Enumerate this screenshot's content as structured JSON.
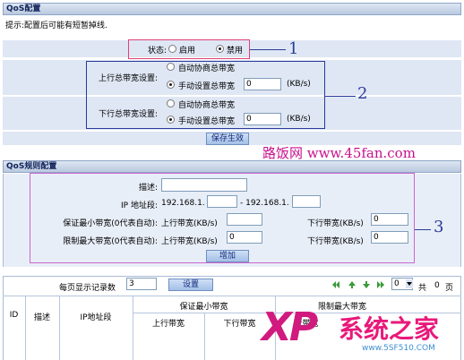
{
  "qos": {
    "title": "QoS配置",
    "tip": "提示:配置后可能有短暂掉线.",
    "state_label": "状态:",
    "enable_label": "启用",
    "disable_label": "禁用",
    "state_selected": "disable",
    "up_label": "上行总带宽设置:",
    "down_label": "下行总带宽设置:",
    "auto_label": "自动协商总带宽",
    "manual_label": "手动设置总带宽",
    "up_value": "0",
    "down_value": "0",
    "unit": "(KB/s)",
    "save_button": "保存生效"
  },
  "watermark": {
    "text": "路饭网 www.45fan.com",
    "logo_text": "系统之家",
    "logo_url": "www.5SF510.COM",
    "xp": "XP"
  },
  "callouts": [
    "1",
    "2",
    "3"
  ],
  "rules": {
    "title": "QoS规则配置",
    "desc_label": "描述:",
    "ip_label": "IP 地址段:",
    "ip_prefix_a": "192.168.1.",
    "ip_sep": "- 192.168.1.",
    "min_label": "保证最小带宽(0代表自动):",
    "max_label": "限制最大带宽(0代表自动):",
    "up_bw_label": "上行带宽(KB/s)",
    "down_bw_label": "下行带宽(KB/s)",
    "min_down_value": "0",
    "max_up_value": "0",
    "max_down_value": "0",
    "add_button": "增加"
  },
  "list": {
    "per_page_label": "每页显示记录数",
    "per_page_value": "3",
    "set_button": "设置",
    "page_value": "0",
    "total_prefix": "共",
    "total_value": "0",
    "total_suffix": "页",
    "columns": {
      "id": "ID",
      "desc": "描述",
      "ip": "IP地址段",
      "min": "保证最小带宽",
      "max": "限制最大带宽",
      "up": "上行带宽",
      "down": "下行带宽",
      "max_up": "行带宽"
    }
  },
  "colors": {
    "callout1": "#e0407a",
    "callout2": "#2a3a9a",
    "callout3": "#cc66cc",
    "watermark": "#c8108c"
  }
}
